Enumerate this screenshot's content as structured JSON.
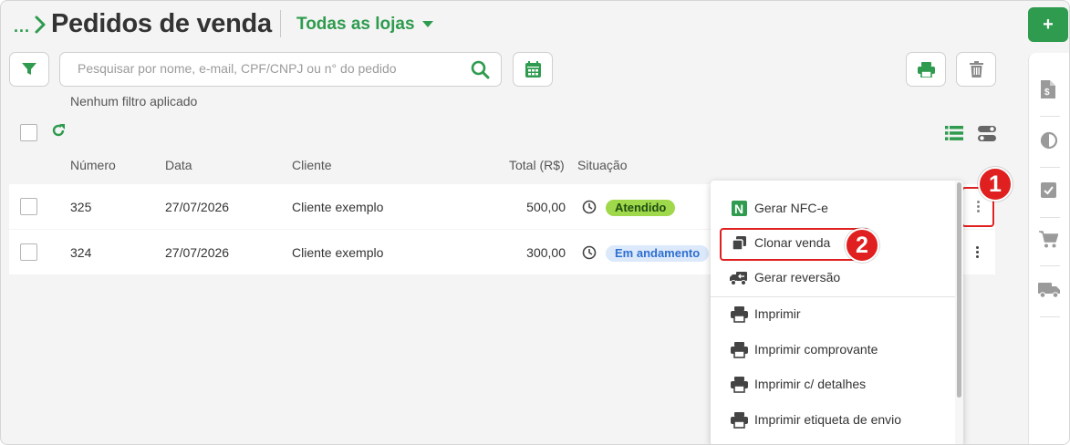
{
  "header": {
    "breadcrumb_ellipsis": "...",
    "title": "Pedidos de venda",
    "store_select": "Todas as lojas"
  },
  "toolbar": {
    "search_placeholder": "Pesquisar por nome, e-mail, CPF/CNPJ ou n° do pedido",
    "filter_status": "Nenhum filtro aplicado",
    "add_label": "+"
  },
  "table": {
    "columns": [
      "Número",
      "Data",
      "Cliente",
      "Total (R$)",
      "Situação"
    ],
    "rows": [
      {
        "numero": "325",
        "data": "27/07/2026",
        "cliente": "Cliente exemplo",
        "total": "500,00",
        "situacao": "Atendido"
      },
      {
        "numero": "324",
        "data": "27/07/2026",
        "cliente": "Cliente exemplo",
        "total": "300,00",
        "situacao": "Em andamento"
      }
    ]
  },
  "menu": {
    "items": [
      {
        "label": "Gerar NFC-e",
        "icon": "nfce-n-icon"
      },
      {
        "label": "Clonar venda",
        "icon": "clone-icon"
      },
      {
        "label": "Gerar reversão",
        "icon": "truck-return-icon"
      },
      {
        "label": "Imprimir",
        "icon": "printer-icon"
      },
      {
        "label": "Imprimir comprovante",
        "icon": "printer-icon"
      },
      {
        "label": "Imprimir c/ detalhes",
        "icon": "printer-icon"
      },
      {
        "label": "Imprimir etiqueta de envio",
        "icon": "printer-icon"
      }
    ]
  },
  "callouts": [
    "1",
    "2"
  ],
  "right_panel": {
    "icons": [
      "invoice-dollar-icon",
      "contrast-icon",
      "checkbox-icon",
      "cart-icon",
      "truck-icon"
    ]
  },
  "colors": {
    "brand_green": "#2e9b4e",
    "badge_done_bg": "#9fd84a",
    "badge_progress_bg": "#dce9fb",
    "badge_progress_text": "#2f6fd0",
    "callout_red": "#e02020"
  }
}
